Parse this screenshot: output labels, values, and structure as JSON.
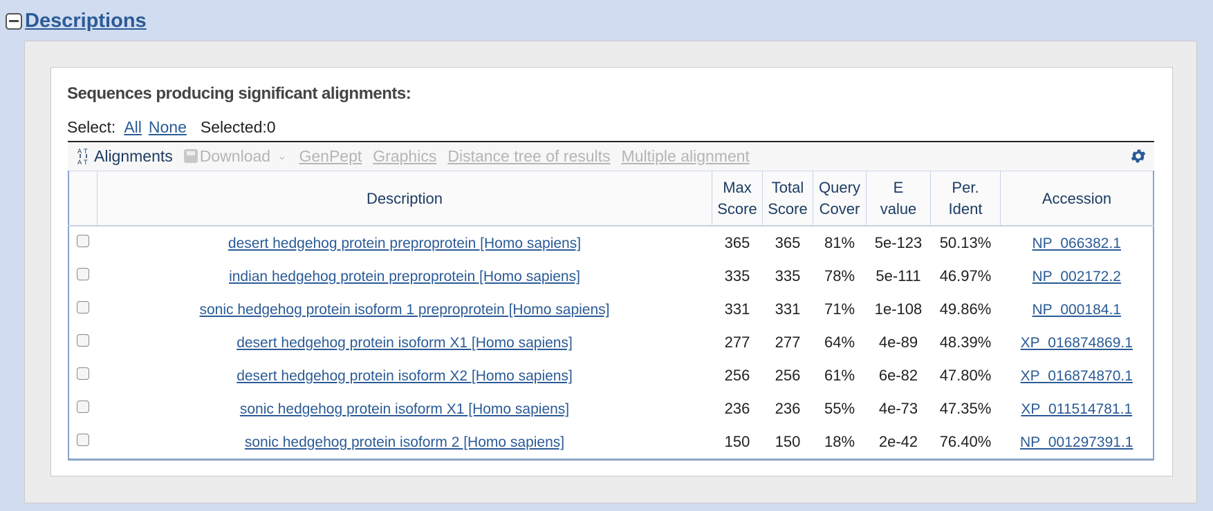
{
  "section": {
    "title": "Descriptions"
  },
  "heading": "Sequences producing significant alignments:",
  "select": {
    "label": "Select:",
    "all": "All",
    "none": "None",
    "selected": "Selected:0"
  },
  "toolbar": {
    "alignments": "Alignments",
    "download": "Download",
    "genpept": "GenPept",
    "graphics": "Graphics",
    "distance_tree": "Distance tree of results",
    "multiple_alignment": "Multiple alignment"
  },
  "table": {
    "headers": {
      "description": "Description",
      "max_score_1": "Max",
      "max_score_2": "Score",
      "total_score_1": "Total",
      "total_score_2": "Score",
      "query_cover_1": "Query",
      "query_cover_2": "Cover",
      "e_value_1": "E",
      "e_value_2": "value",
      "per_ident_1": "Per.",
      "per_ident_2": "Ident",
      "accession": "Accession"
    },
    "rows": [
      {
        "description": "desert hedgehog protein preproprotein [Homo sapiens]",
        "max_score": "365",
        "total_score": "365",
        "query_cover": "81%",
        "e_value": "5e-123",
        "per_ident": "50.13%",
        "accession": "NP_066382.1"
      },
      {
        "description": "indian hedgehog protein preproprotein [Homo sapiens]",
        "max_score": "335",
        "total_score": "335",
        "query_cover": "78%",
        "e_value": "5e-111",
        "per_ident": "46.97%",
        "accession": "NP_002172.2"
      },
      {
        "description": "sonic hedgehog protein isoform 1 preproprotein [Homo sapiens]",
        "max_score": "331",
        "total_score": "331",
        "query_cover": "71%",
        "e_value": "1e-108",
        "per_ident": "49.86%",
        "accession": "NP_000184.1"
      },
      {
        "description": "desert hedgehog protein isoform X1 [Homo sapiens]",
        "max_score": "277",
        "total_score": "277",
        "query_cover": "64%",
        "e_value": "4e-89",
        "per_ident": "48.39%",
        "accession": "XP_016874869.1"
      },
      {
        "description": "desert hedgehog protein isoform X2 [Homo sapiens]",
        "max_score": "256",
        "total_score": "256",
        "query_cover": "61%",
        "e_value": "6e-82",
        "per_ident": "47.80%",
        "accession": "XP_016874870.1"
      },
      {
        "description": "sonic hedgehog protein isoform X1 [Homo sapiens]",
        "max_score": "236",
        "total_score": "236",
        "query_cover": "55%",
        "e_value": "4e-73",
        "per_ident": "47.35%",
        "accession": "XP_011514781.1"
      },
      {
        "description": "sonic hedgehog protein isoform 2 [Homo sapiens]",
        "max_score": "150",
        "total_score": "150",
        "query_cover": "18%",
        "e_value": "2e-42",
        "per_ident": "76.40%",
        "accession": "NP_001297391.1"
      }
    ]
  }
}
